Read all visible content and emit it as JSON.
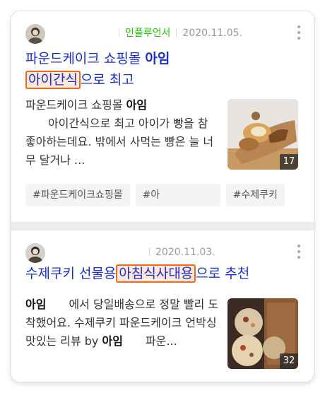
{
  "posts": [
    {
      "badge": "인플루언서",
      "date": "2020.11.05.",
      "title_pre": "파운드케이크 쇼핑몰 ",
      "title_bold": "아임",
      "title_hl": "아이간식",
      "title_post": "으로 최고",
      "desc_pre": "파운드케이크 쇼핑몰 ",
      "desc_bold": "아임",
      "desc_rest": "　　아이간식으로 최고 아이가 빵을 참 좋아하는데요. 밖에서 사먹는 빵은 늘 너무 달거나 ...",
      "photo_count": "17",
      "tags": [
        "#파운드케이크쇼핑몰",
        "#아",
        "#수제쿠키"
      ]
    },
    {
      "date": "2020.11.03.",
      "title_pre": "수제쿠키 선물용",
      "title_hl": "아침식사대용",
      "title_post": "으로 추천",
      "desc_bold1": "아임",
      "desc_mid": "　　에서 당일배송으로 정말 빨리 도착했어요. 수제쿠키 파운드케이크 언박싱 맛있는 리뷰 by ",
      "desc_bold2": "아임",
      "desc_end": "　　파운...",
      "photo_count": "32"
    }
  ],
  "icons": {
    "more": "more-vertical-icon"
  },
  "colors": {
    "link": "#1a2fd0",
    "badge": "#1ec800",
    "highlight_border": "#ee6a1c"
  }
}
